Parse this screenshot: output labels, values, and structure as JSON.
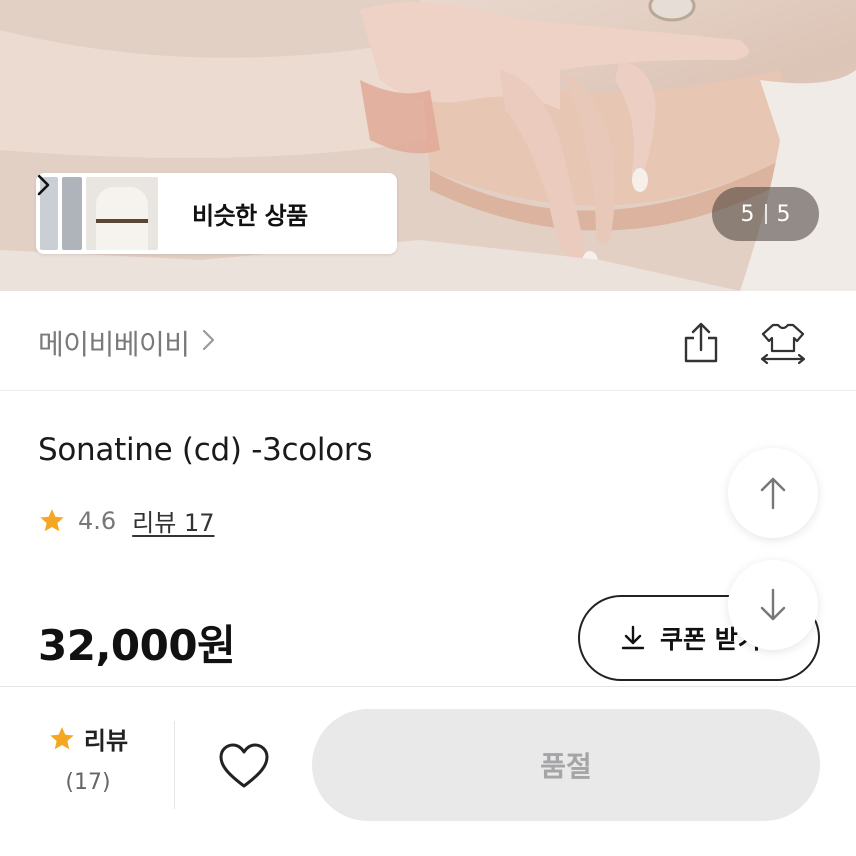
{
  "gallery": {
    "similar_label": "비슷한 상품",
    "current": "5",
    "total": "5"
  },
  "brand": {
    "name": "메이비베이비"
  },
  "product": {
    "title": "Sonatine (cd) -3colors",
    "rating": "4.6",
    "review_link": "리뷰 17",
    "price": "32,000원",
    "coupon_label": "쿠폰 받기"
  },
  "bottom_bar": {
    "review_label": "리뷰",
    "review_count": "(17)",
    "soldout_label": "품절"
  },
  "colors": {
    "star": "#f5a623",
    "soldout_bg": "#e9e9ea",
    "soldout_text": "#a5a5a7"
  },
  "icons": {
    "share": "share-icon",
    "fit": "body-size-icon",
    "star": "star-icon",
    "heart": "heart-outline-icon",
    "up": "arrow-up-icon",
    "down": "arrow-down-icon",
    "download": "download-icon",
    "chevron": "chevron-right-icon"
  }
}
